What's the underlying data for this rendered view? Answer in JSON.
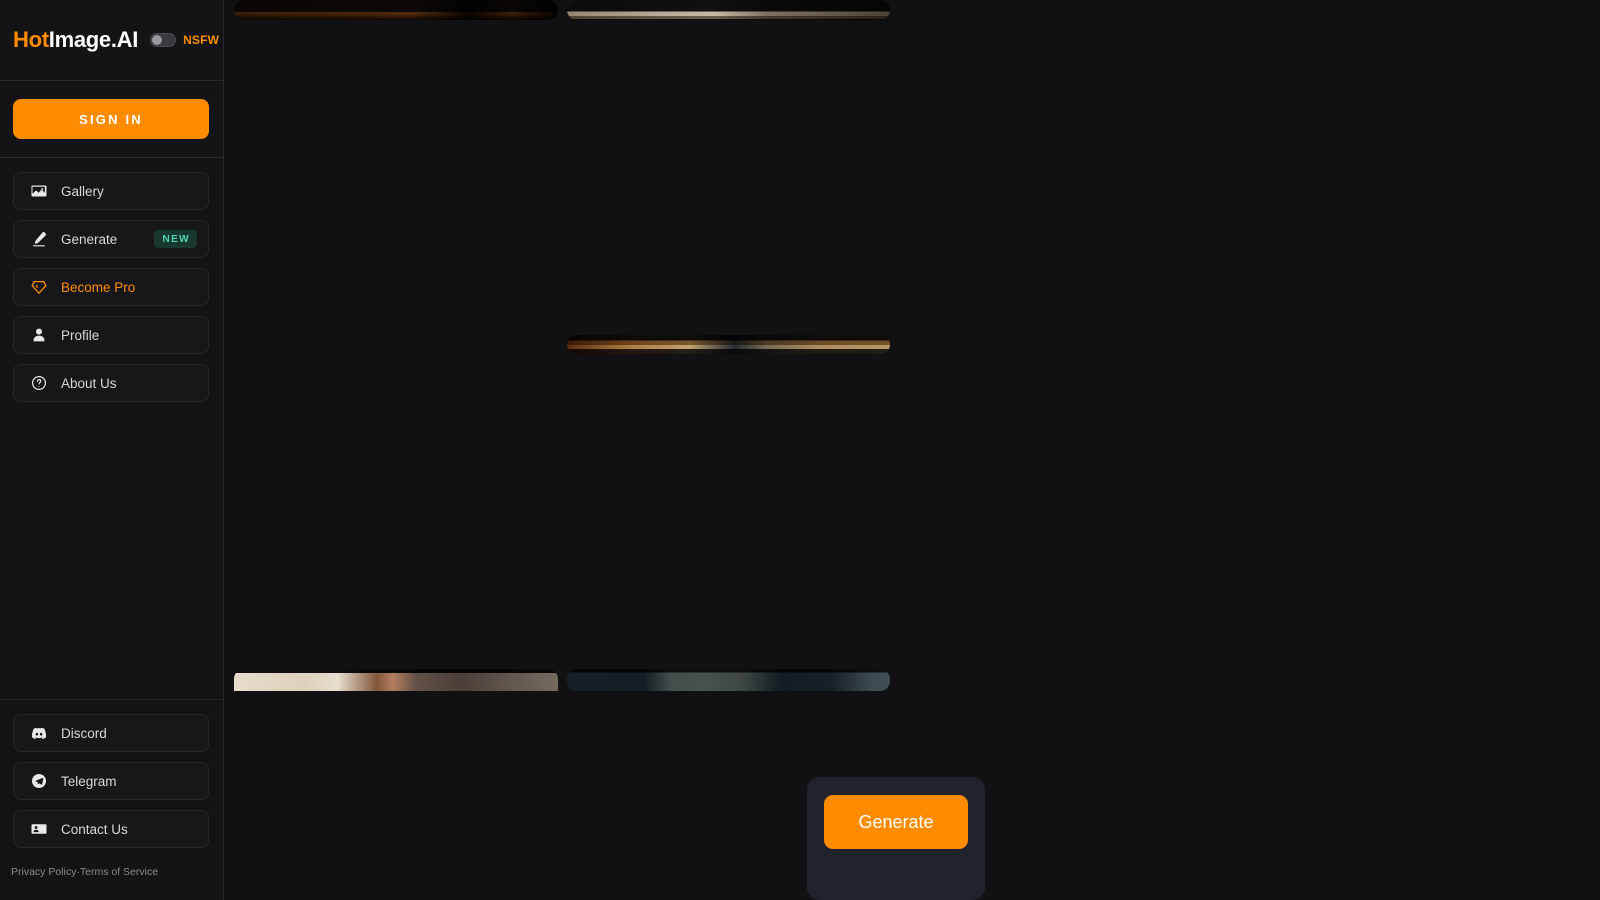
{
  "app": {
    "brand_prefix": "Hot",
    "brand_suffix": "Image.AI",
    "accent_color": "#ff8c00",
    "background_color": "#111113",
    "sidebar_color": "#141416",
    "panel_color": "#20232c",
    "badge_color": "#4fd6ae"
  },
  "header": {
    "nsfw_label": "NSFW",
    "nsfw_enabled": false,
    "nsfw_toggle_icon": "toggle-off-icon"
  },
  "auth": {
    "sign_in_label": "SIGN IN"
  },
  "sidebar": {
    "items": [
      {
        "label": "Gallery",
        "icon": "image-icon",
        "badge": null,
        "accent": false
      },
      {
        "label": "Generate",
        "icon": "pencil-icon",
        "badge": "NEW",
        "accent": false
      },
      {
        "label": "Become Pro",
        "icon": "diamond-icon",
        "badge": null,
        "accent": true
      },
      {
        "label": "Profile",
        "icon": "person-icon",
        "badge": null,
        "accent": false
      },
      {
        "label": "About Us",
        "icon": "question-circle-icon",
        "badge": null,
        "accent": false
      }
    ],
    "bottom_items": [
      {
        "label": "Discord",
        "icon": "discord-icon"
      },
      {
        "label": "Telegram",
        "icon": "telegram-icon"
      },
      {
        "label": "Contact Us",
        "icon": "contact-card-icon"
      }
    ],
    "footer": {
      "privacy_label": "Privacy Policy",
      "separator": "·",
      "terms_label": "Terms of Service"
    }
  },
  "main": {
    "generate_panel": {
      "generate_label": "Generate"
    }
  }
}
